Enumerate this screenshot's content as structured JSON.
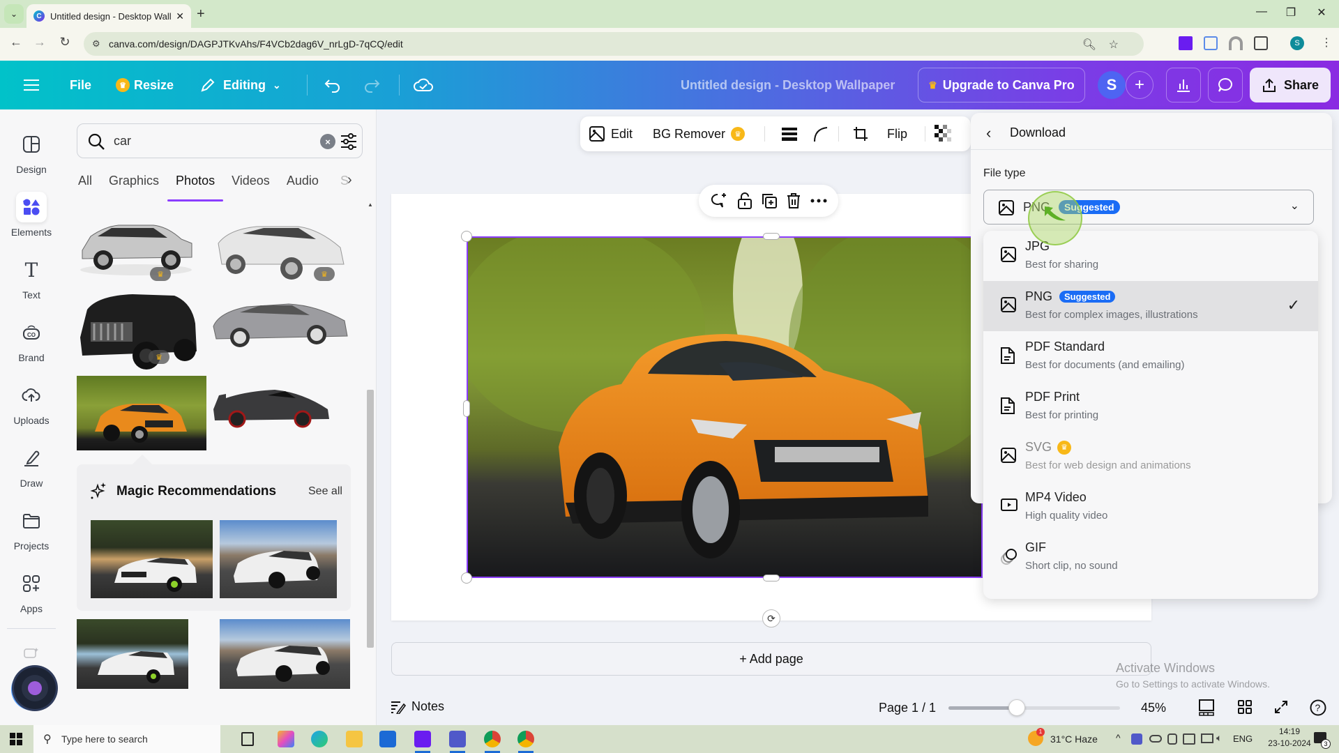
{
  "browser": {
    "tab_title": "Untitled design - Desktop Wallp",
    "url": "canva.com/design/DAGPJTKvAhs/F4VCb2dag6V_nrLgD-7qCQ/edit",
    "profile_initial": "S"
  },
  "topbar": {
    "file_label": "File",
    "resize_label": "Resize",
    "editing_label": "Editing",
    "doc_title": "Untitled design - Desktop Wallpaper",
    "upgrade_label": "Upgrade to Canva Pro",
    "avatar_initial": "S",
    "share_label": "Share",
    "gradient_start": "#01c2c9",
    "gradient_end": "#8a2be2"
  },
  "rail": {
    "items": [
      {
        "label": "Design",
        "icon": "layout-icon"
      },
      {
        "label": "Elements",
        "icon": "shapes-icon",
        "active": true
      },
      {
        "label": "Text",
        "icon": "text-icon"
      },
      {
        "label": "Brand",
        "icon": "brand-icon"
      },
      {
        "label": "Uploads",
        "icon": "cloud-upload-icon"
      },
      {
        "label": "Draw",
        "icon": "pen-icon"
      },
      {
        "label": "Projects",
        "icon": "folder-icon"
      },
      {
        "label": "Apps",
        "icon": "apps-icon"
      }
    ]
  },
  "panel": {
    "search_value": "car",
    "tabs": [
      "All",
      "Graphics",
      "Photos",
      "Videos",
      "Audio"
    ],
    "active_tab": "Photos",
    "tabs_more": "S",
    "magic_title": "Magic Recommendations",
    "magic_see_all": "See all"
  },
  "canvas_toolbar": {
    "edit_label": "Edit",
    "bg_remover_label": "BG Remover",
    "flip_label": "Flip"
  },
  "canvas": {
    "add_page_label": "+ Add page"
  },
  "bottombar": {
    "notes_label": "Notes",
    "page_indicator": "Page 1 / 1",
    "zoom_label": "45%",
    "zoom_fraction": 0.4
  },
  "download": {
    "title": "Download",
    "file_type_label": "File type",
    "selected_value": "PNG",
    "selected_badge": "Suggested",
    "options": [
      {
        "name": "JPG",
        "desc": "Best for sharing",
        "icon": "image-icon"
      },
      {
        "name": "PNG",
        "badge": "Suggested",
        "desc": "Best for complex images, illustrations",
        "icon": "image-icon",
        "selected": true
      },
      {
        "name": "PDF Standard",
        "desc": "Best for documents (and emailing)",
        "icon": "document-icon"
      },
      {
        "name": "PDF Print",
        "desc": "Best for printing",
        "icon": "document-icon"
      },
      {
        "name": "SVG",
        "pro": true,
        "desc": "Best for web design and animations",
        "icon": "image-icon"
      },
      {
        "name": "MP4 Video",
        "desc": "High quality video",
        "icon": "video-icon"
      },
      {
        "name": "GIF",
        "desc": "Short clip, no sound",
        "icon": "gif-icon"
      }
    ],
    "badge_color": "#1a6cf5",
    "pro_color": "#f8b818"
  },
  "watermark": {
    "line1": "Activate Windows",
    "line2": "Go to Settings to activate Windows."
  },
  "taskbar": {
    "search_placeholder": "Type here to search",
    "weather": "31°C  Haze",
    "weather_badge": "1",
    "lang": "ENG",
    "time": "14:19",
    "date": "23-10-2024",
    "notif_count": "3"
  }
}
